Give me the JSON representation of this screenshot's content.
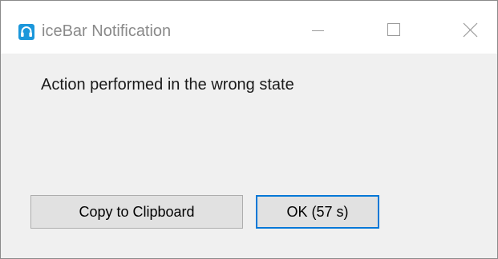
{
  "window": {
    "title": "iceBar Notification",
    "icon": "headset-icon",
    "controls": {
      "minimize_icon": "minimize-icon",
      "maximize_icon": "maximize-icon",
      "close_icon": "close-icon"
    }
  },
  "dialog": {
    "message": "Action performed in the wrong state"
  },
  "buttons": {
    "copy_label": "Copy to Clipboard",
    "ok_label": "OK (57 s)"
  },
  "colors": {
    "accent": "#0078d7",
    "icon_background": "#1b97db",
    "dialog_background": "#f0f0f0",
    "button_background": "#e1e1e1"
  }
}
